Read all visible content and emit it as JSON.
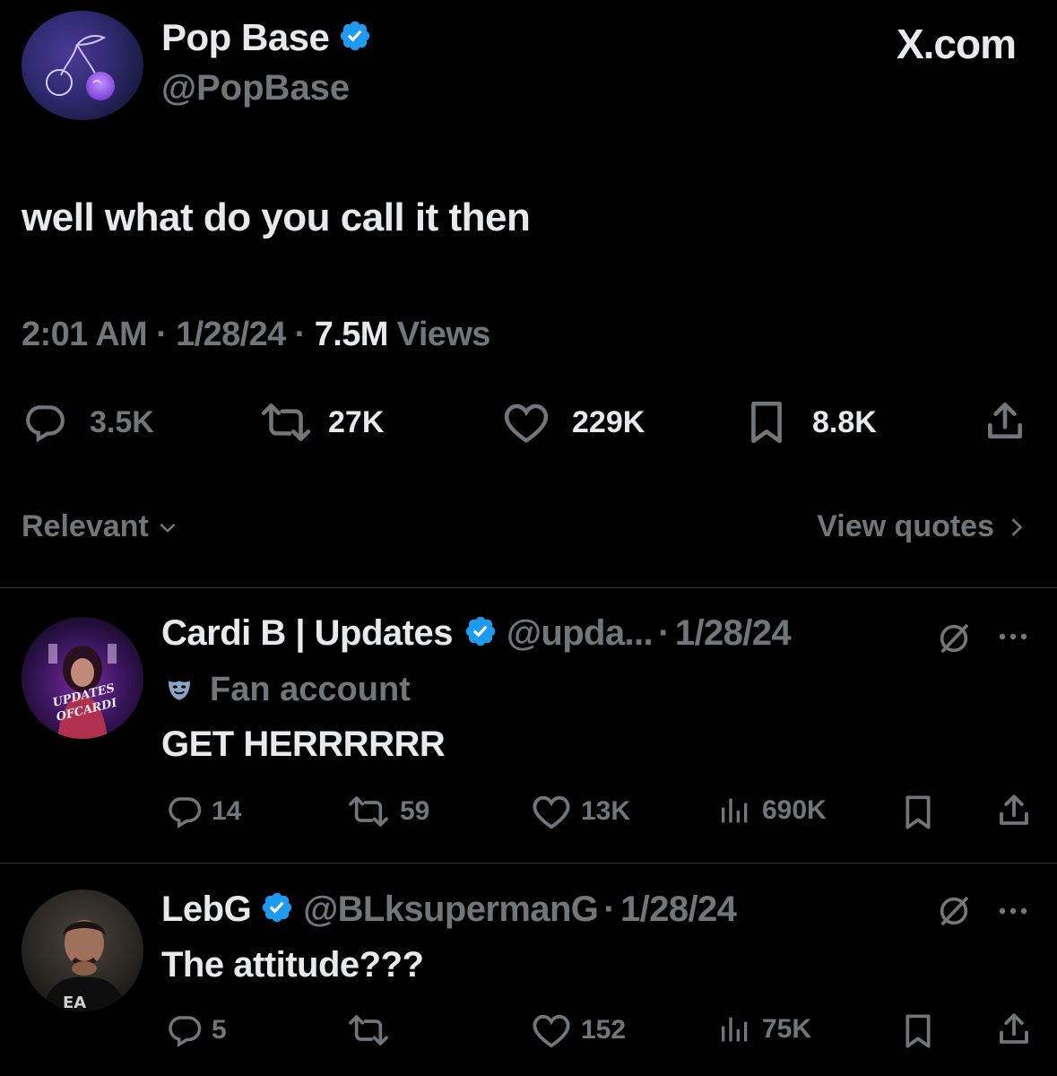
{
  "brand": "X.com",
  "colors": {
    "background": "#000000",
    "text": "#e7e9ea",
    "muted": "#71767b",
    "verified": "#1d9bf0",
    "divider": "#2f3336"
  },
  "main_tweet": {
    "name": "Pop Base",
    "handle": "@PopBase",
    "text": "well what do you call it then",
    "time": "2:01 AM",
    "date": "1/28/24",
    "views_count": "7.5M",
    "views_label": "Views",
    "sep": "·",
    "actions": {
      "replies": "3.5K",
      "reposts": "27K",
      "likes": "229K",
      "bookmarks": "8.8K"
    },
    "icons": [
      "reply-icon",
      "repost-icon",
      "like-icon",
      "bookmark-icon",
      "share-icon"
    ]
  },
  "sort": {
    "label": "Relevant",
    "quotes": "View quotes"
  },
  "replies": [
    {
      "name": "Cardi B | Updates",
      "handle": "@upda...",
      "date": "1/28/24",
      "badge": "Fan account",
      "text": "GET HERRRRRR",
      "avatar_text": "UPDATES OFCARDI",
      "actions": {
        "replies": "14",
        "reposts": "59",
        "likes": "13K",
        "views": "690K"
      }
    },
    {
      "name": "LebG",
      "handle": "@BLksupermanG",
      "date": "1/28/24",
      "text": "The attitude???",
      "actions": {
        "replies": "5",
        "reposts": "",
        "likes": "152",
        "views": "75K"
      }
    }
  ]
}
